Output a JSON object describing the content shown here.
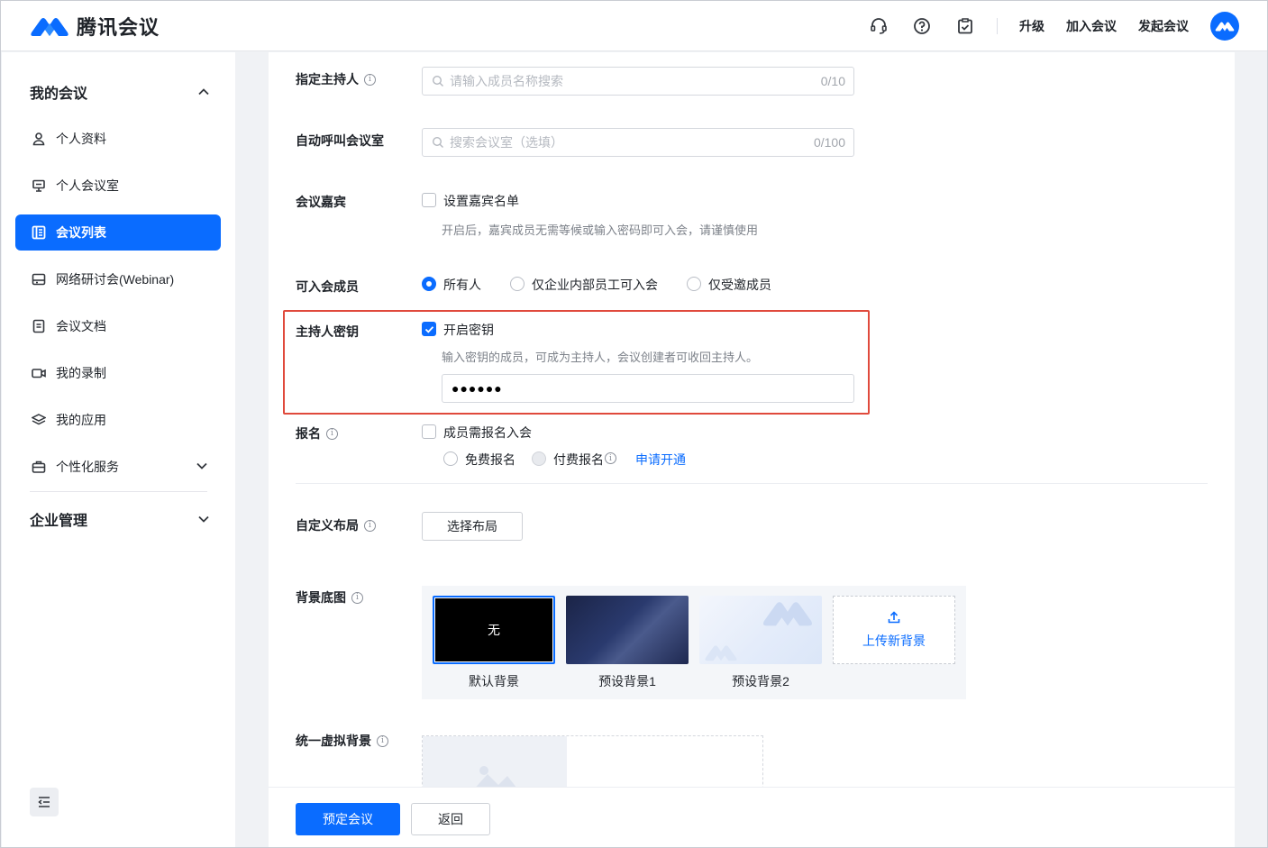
{
  "brand": {
    "name": "腾讯会议",
    "logo_icon": "tencent-meeting-logo"
  },
  "topbar": {
    "icons": [
      "headset-icon",
      "help-icon",
      "clipboard-check-icon"
    ],
    "upgrade": "升级",
    "join_meeting": "加入会议",
    "start_meeting": "发起会议"
  },
  "sidebar": {
    "my_meetings": "我的会议",
    "items": [
      {
        "label": "个人资料",
        "icon": "user-icon"
      },
      {
        "label": "个人会议室",
        "icon": "presentation-icon"
      },
      {
        "label": "会议列表",
        "icon": "list-icon",
        "active": true
      },
      {
        "label": "网络研讨会(Webinar)",
        "icon": "webinar-icon"
      },
      {
        "label": "会议文档",
        "icon": "document-icon"
      },
      {
        "label": "我的录制",
        "icon": "video-icon"
      },
      {
        "label": "我的应用",
        "icon": "layers-icon"
      },
      {
        "label": "个性化服务",
        "icon": "briefcase-icon"
      }
    ],
    "enterprise": "企业管理"
  },
  "form": {
    "host": {
      "label": "指定主持人",
      "placeholder": "请输入成员名称搜索",
      "count": "0/10"
    },
    "auto_call": {
      "label": "自动呼叫会议室",
      "placeholder": "搜索会议室（选填）",
      "count": "0/100"
    },
    "guests": {
      "label": "会议嘉宾",
      "checkbox": "设置嘉宾名单",
      "hint": "开启后，嘉宾成员无需等候或输入密码即可入会，请谨慎使用",
      "checked": false
    },
    "members": {
      "label": "可入会成员",
      "options": [
        "所有人",
        "仅企业内部员工可入会",
        "仅受邀成员"
      ],
      "selected": "所有人"
    },
    "host_key": {
      "label": "主持人密钥",
      "checkbox": "开启密钥",
      "checked": true,
      "hint": "输入密钥的成员，可成为主持人，会议创建者可收回主持人。",
      "value": "●●●●●●"
    },
    "signup": {
      "label": "报名",
      "checkbox": "成员需报名入会",
      "free": "免费报名",
      "paid": "付费报名",
      "apply_link": "申请开通"
    },
    "layout": {
      "label": "自定义布局",
      "button": "选择布局"
    },
    "background": {
      "label": "背景底图",
      "none_text": "无",
      "items": [
        "默认背景",
        "预设背景1",
        "预设背景2"
      ],
      "upload": "上传新背景"
    },
    "virtual_bg": {
      "label": "统一虚拟背景"
    }
  },
  "footer": {
    "submit": "预定会议",
    "back": "返回"
  }
}
